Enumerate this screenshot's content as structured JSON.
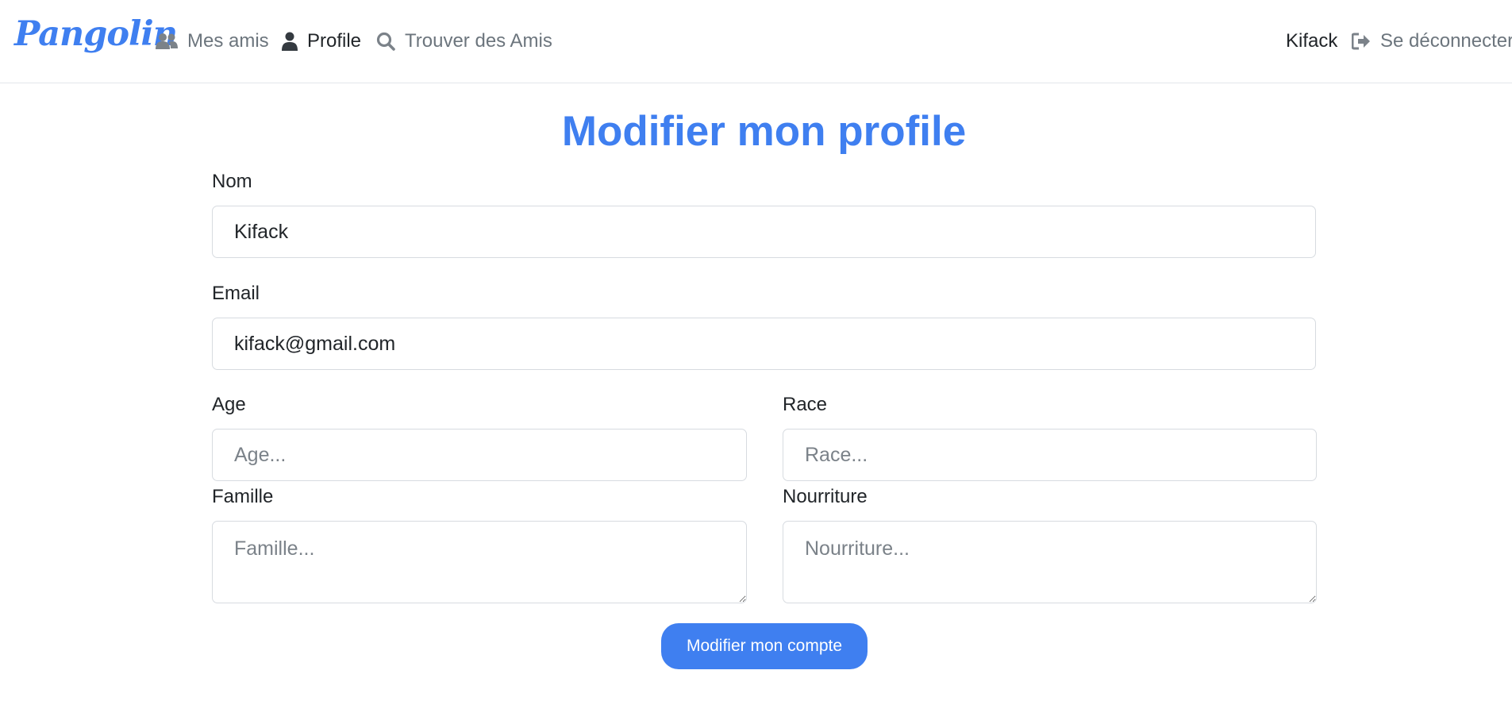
{
  "navbar": {
    "brand": "Pangolin",
    "friends_label": "Mes amis",
    "profile_label": "Profile",
    "find_label": "Trouver des Amis",
    "user_name": "Kifack",
    "logout_label": "Se déconnecter"
  },
  "form": {
    "title": "Modifier mon profile",
    "nom_label": "Nom",
    "nom_value": "Kifack",
    "email_label": "Email",
    "email_value": "kifack@gmail.com",
    "age_label": "Age",
    "age_placeholder": "Age...",
    "race_label": "Race",
    "race_placeholder": "Race...",
    "famille_label": "Famille",
    "famille_placeholder": "Famille...",
    "nourriture_label": "Nourriture",
    "nourriture_placeholder": "Nourriture...",
    "submit_label": "Modifier mon compte"
  },
  "colors": {
    "accent": "#3f7ff0",
    "muted_text": "#6c757d",
    "text": "#212529"
  },
  "icons": [
    "users-icon",
    "user-icon",
    "search-icon",
    "logout-icon"
  ]
}
